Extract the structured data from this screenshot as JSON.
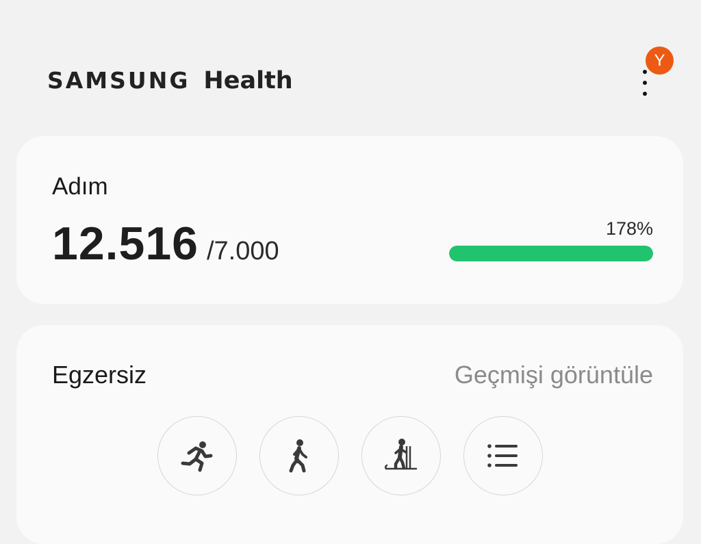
{
  "header": {
    "brand_primary": "SAMSUNG",
    "brand_secondary": "Health",
    "avatar_initial": "Y",
    "avatar_color": "#ec5a14"
  },
  "steps": {
    "title": "Adım",
    "count": "12.516",
    "goal": "/7.000",
    "percent_label": "178%",
    "progress_fraction": 1.0,
    "progress_color": "#22c36e"
  },
  "exercise": {
    "title": "Egzersiz",
    "history_link": "Geçmişi görüntüle",
    "buttons": [
      {
        "icon": "running-icon"
      },
      {
        "icon": "walking-icon"
      },
      {
        "icon": "cross-country-ski-icon"
      },
      {
        "icon": "list-icon"
      }
    ]
  }
}
